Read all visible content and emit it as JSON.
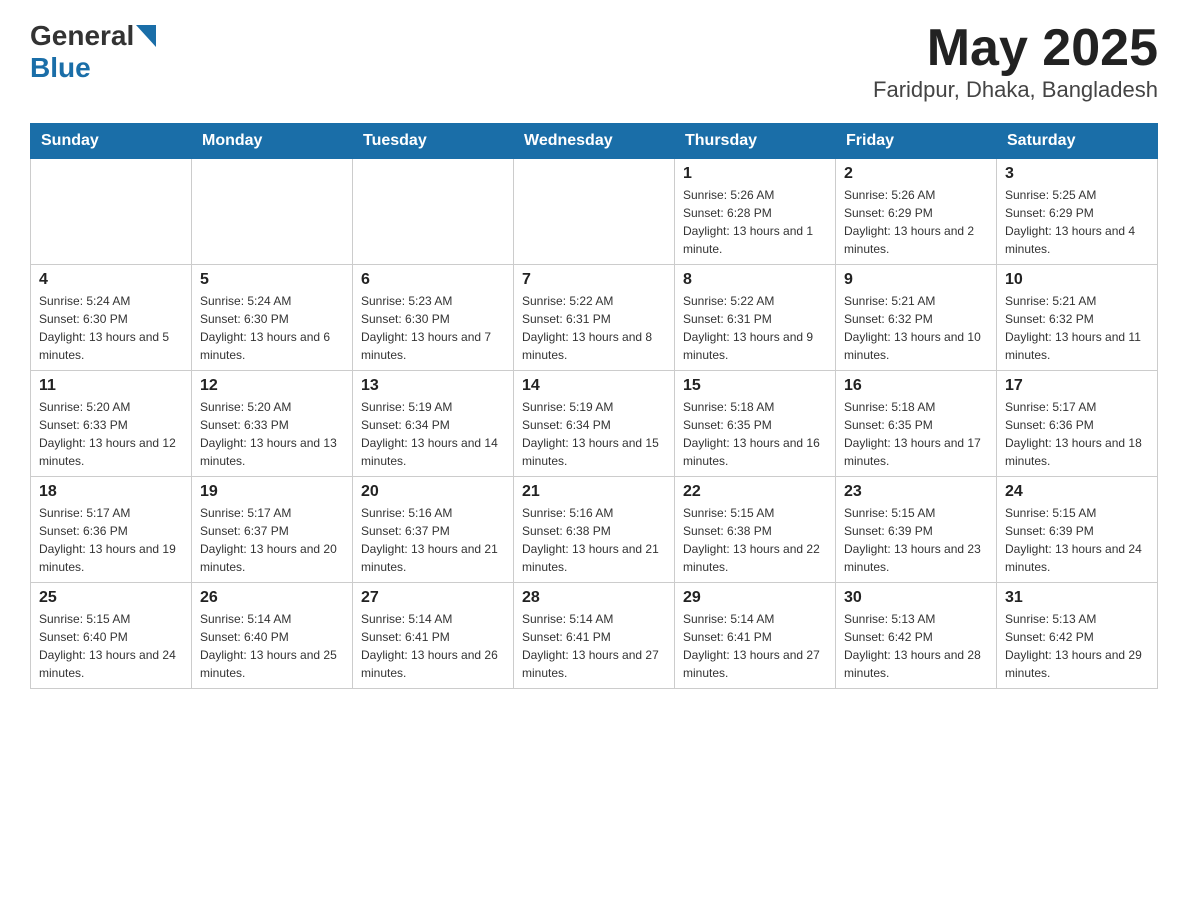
{
  "header": {
    "logo_general": "General",
    "logo_blue": "Blue",
    "title": "May 2025",
    "subtitle": "Faridpur, Dhaka, Bangladesh"
  },
  "days": [
    "Sunday",
    "Monday",
    "Tuesday",
    "Wednesday",
    "Thursday",
    "Friday",
    "Saturday"
  ],
  "weeks": [
    [
      {
        "day": "",
        "info": ""
      },
      {
        "day": "",
        "info": ""
      },
      {
        "day": "",
        "info": ""
      },
      {
        "day": "",
        "info": ""
      },
      {
        "day": "1",
        "info": "Sunrise: 5:26 AM\nSunset: 6:28 PM\nDaylight: 13 hours and 1 minute."
      },
      {
        "day": "2",
        "info": "Sunrise: 5:26 AM\nSunset: 6:29 PM\nDaylight: 13 hours and 2 minutes."
      },
      {
        "day": "3",
        "info": "Sunrise: 5:25 AM\nSunset: 6:29 PM\nDaylight: 13 hours and 4 minutes."
      }
    ],
    [
      {
        "day": "4",
        "info": "Sunrise: 5:24 AM\nSunset: 6:30 PM\nDaylight: 13 hours and 5 minutes."
      },
      {
        "day": "5",
        "info": "Sunrise: 5:24 AM\nSunset: 6:30 PM\nDaylight: 13 hours and 6 minutes."
      },
      {
        "day": "6",
        "info": "Sunrise: 5:23 AM\nSunset: 6:30 PM\nDaylight: 13 hours and 7 minutes."
      },
      {
        "day": "7",
        "info": "Sunrise: 5:22 AM\nSunset: 6:31 PM\nDaylight: 13 hours and 8 minutes."
      },
      {
        "day": "8",
        "info": "Sunrise: 5:22 AM\nSunset: 6:31 PM\nDaylight: 13 hours and 9 minutes."
      },
      {
        "day": "9",
        "info": "Sunrise: 5:21 AM\nSunset: 6:32 PM\nDaylight: 13 hours and 10 minutes."
      },
      {
        "day": "10",
        "info": "Sunrise: 5:21 AM\nSunset: 6:32 PM\nDaylight: 13 hours and 11 minutes."
      }
    ],
    [
      {
        "day": "11",
        "info": "Sunrise: 5:20 AM\nSunset: 6:33 PM\nDaylight: 13 hours and 12 minutes."
      },
      {
        "day": "12",
        "info": "Sunrise: 5:20 AM\nSunset: 6:33 PM\nDaylight: 13 hours and 13 minutes."
      },
      {
        "day": "13",
        "info": "Sunrise: 5:19 AM\nSunset: 6:34 PM\nDaylight: 13 hours and 14 minutes."
      },
      {
        "day": "14",
        "info": "Sunrise: 5:19 AM\nSunset: 6:34 PM\nDaylight: 13 hours and 15 minutes."
      },
      {
        "day": "15",
        "info": "Sunrise: 5:18 AM\nSunset: 6:35 PM\nDaylight: 13 hours and 16 minutes."
      },
      {
        "day": "16",
        "info": "Sunrise: 5:18 AM\nSunset: 6:35 PM\nDaylight: 13 hours and 17 minutes."
      },
      {
        "day": "17",
        "info": "Sunrise: 5:17 AM\nSunset: 6:36 PM\nDaylight: 13 hours and 18 minutes."
      }
    ],
    [
      {
        "day": "18",
        "info": "Sunrise: 5:17 AM\nSunset: 6:36 PM\nDaylight: 13 hours and 19 minutes."
      },
      {
        "day": "19",
        "info": "Sunrise: 5:17 AM\nSunset: 6:37 PM\nDaylight: 13 hours and 20 minutes."
      },
      {
        "day": "20",
        "info": "Sunrise: 5:16 AM\nSunset: 6:37 PM\nDaylight: 13 hours and 21 minutes."
      },
      {
        "day": "21",
        "info": "Sunrise: 5:16 AM\nSunset: 6:38 PM\nDaylight: 13 hours and 21 minutes."
      },
      {
        "day": "22",
        "info": "Sunrise: 5:15 AM\nSunset: 6:38 PM\nDaylight: 13 hours and 22 minutes."
      },
      {
        "day": "23",
        "info": "Sunrise: 5:15 AM\nSunset: 6:39 PM\nDaylight: 13 hours and 23 minutes."
      },
      {
        "day": "24",
        "info": "Sunrise: 5:15 AM\nSunset: 6:39 PM\nDaylight: 13 hours and 24 minutes."
      }
    ],
    [
      {
        "day": "25",
        "info": "Sunrise: 5:15 AM\nSunset: 6:40 PM\nDaylight: 13 hours and 24 minutes."
      },
      {
        "day": "26",
        "info": "Sunrise: 5:14 AM\nSunset: 6:40 PM\nDaylight: 13 hours and 25 minutes."
      },
      {
        "day": "27",
        "info": "Sunrise: 5:14 AM\nSunset: 6:41 PM\nDaylight: 13 hours and 26 minutes."
      },
      {
        "day": "28",
        "info": "Sunrise: 5:14 AM\nSunset: 6:41 PM\nDaylight: 13 hours and 27 minutes."
      },
      {
        "day": "29",
        "info": "Sunrise: 5:14 AM\nSunset: 6:41 PM\nDaylight: 13 hours and 27 minutes."
      },
      {
        "day": "30",
        "info": "Sunrise: 5:13 AM\nSunset: 6:42 PM\nDaylight: 13 hours and 28 minutes."
      },
      {
        "day": "31",
        "info": "Sunrise: 5:13 AM\nSunset: 6:42 PM\nDaylight: 13 hours and 29 minutes."
      }
    ]
  ]
}
